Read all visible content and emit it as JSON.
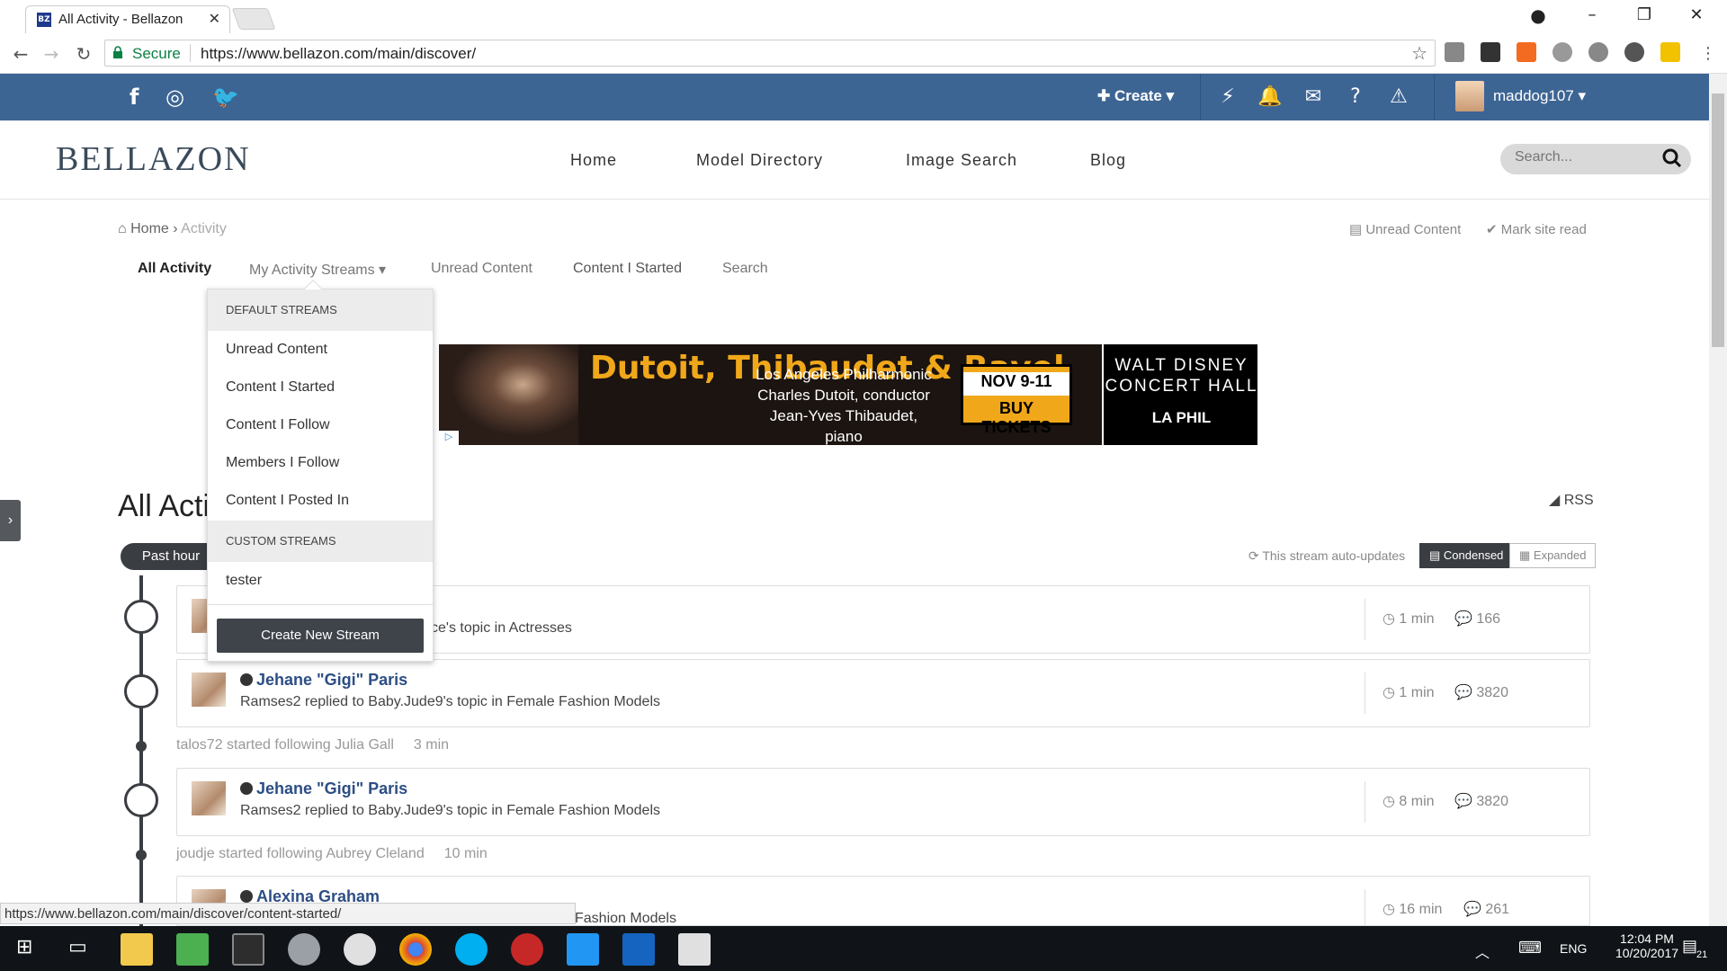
{
  "browser": {
    "tab_title": "All Activity - Bellazon",
    "tab_favicon": "BZ",
    "secure_label": "Secure",
    "url": "https://www.bellazon.com/main/discover/",
    "status_url": "https://www.bellazon.com/main/discover/content-started/"
  },
  "topbar": {
    "create_label": "Create",
    "username": "maddog107"
  },
  "header": {
    "logo": "BELLAZON",
    "nav": [
      "Home",
      "Model Directory",
      "Image Search",
      "Blog"
    ],
    "search_placeholder": "Search..."
  },
  "breadcrumb": {
    "home": "Home",
    "current": "Activity"
  },
  "top_actions": {
    "unread": "Unread Content",
    "mark_read": "Mark site read"
  },
  "page_tabs": [
    "All Activity",
    "My Activity Streams",
    "Unread Content",
    "Content I Started",
    "Search"
  ],
  "dropdown": {
    "default_header": "DEFAULT STREAMS",
    "default_items": [
      "Unread Content",
      "Content I Started",
      "Content I Follow",
      "Members I Follow",
      "Content I Posted In"
    ],
    "custom_header": "CUSTOM STREAMS",
    "custom_items": [
      "tester"
    ],
    "create_button": "Create New Stream"
  },
  "ad": {
    "headline": "Dutoit, Thibaudet & Ravel",
    "line1": "Los Angeles Philharmonic",
    "line2": "Charles Dutoit, conductor",
    "line3": "Jean-Yves Thibaudet, piano",
    "dates": "NOV 9-11",
    "cta": "BUY TICKETS",
    "venue": "WALT DISNEY CONCERT HALL",
    "brand": "LA PHIL"
  },
  "page": {
    "heading": "All Acti",
    "rss": "RSS",
    "filter_pill": "Past hour",
    "auto_updates": "This stream auto-updates",
    "view_condensed": "Condensed",
    "view_expanded": "Expanded"
  },
  "stream": [
    {
      "type": "card",
      "name": "",
      "desc": "ce's topic in Actresses",
      "time": "1 min",
      "count": "166"
    },
    {
      "type": "card",
      "name": "Jehane \"Gigi\" Paris",
      "desc": "Ramses2 replied to Baby.Jude9's topic in Female Fashion Models",
      "time": "1 min",
      "count": "3820"
    },
    {
      "type": "follow",
      "text": "talos72 started following Julia Gall",
      "time": "3 min"
    },
    {
      "type": "card",
      "name": "Jehane \"Gigi\" Paris",
      "desc": "Ramses2 replied to Baby.Jude9's topic in Female Fashion Models",
      "time": "8 min",
      "count": "3820"
    },
    {
      "type": "follow",
      "text": "joudje started following Aubrey Cleland",
      "time": "10 min"
    },
    {
      "type": "card",
      "name": "Alexina Graham",
      "desc": "Fashion Models",
      "time": "16 min",
      "count": "261"
    }
  ],
  "taskbar": {
    "language": "ENG",
    "time": "12:04 PM",
    "date": "10/20/2017",
    "notifications": "21"
  },
  "colors": {
    "brand_blue": "#3d6594",
    "link_blue": "#2d4e84",
    "dark": "#3a3d42",
    "ad_orange": "#f0a81a"
  }
}
